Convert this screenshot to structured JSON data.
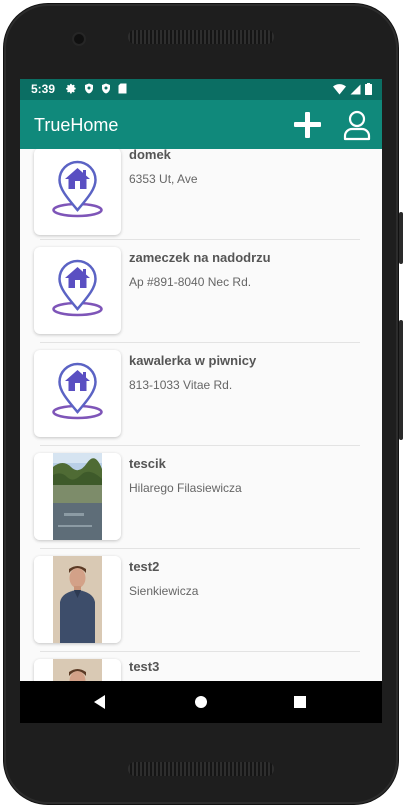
{
  "status_bar": {
    "time": "5:39",
    "left_icons": [
      "gear-icon",
      "shield-icon",
      "shield-icon",
      "sd-card-icon"
    ],
    "right_icons": [
      "wifi-icon",
      "signal-icon",
      "battery-icon"
    ]
  },
  "app_bar": {
    "title": "TrueHome",
    "actions": [
      "add-icon",
      "profile-icon"
    ]
  },
  "colors": {
    "primary": "#10897b",
    "primary_dark": "#0b6e63",
    "placeholder_icon": "#6a4fb0"
  },
  "list": {
    "items": [
      {
        "name": "domek",
        "address": "6353 Ut, Ave",
        "image": "house-pin-icon"
      },
      {
        "name": "zameczek na nadodrzu",
        "address": "Ap #891-8040 Nec Rd.",
        "image": "house-pin-icon"
      },
      {
        "name": "kawalerka w piwnicy",
        "address": "813-1033 Vitae Rd.",
        "image": "house-pin-icon"
      },
      {
        "name": "tescik",
        "address": "Hilarego Filasiewicza",
        "image": "lake-photo"
      },
      {
        "name": "test2",
        "address": "Sienkiewicza",
        "image": "person-photo"
      },
      {
        "name": "test3",
        "address": "",
        "image": "person-photo"
      }
    ]
  },
  "nav_bar": [
    "back-icon",
    "home-icon",
    "recents-icon"
  ]
}
